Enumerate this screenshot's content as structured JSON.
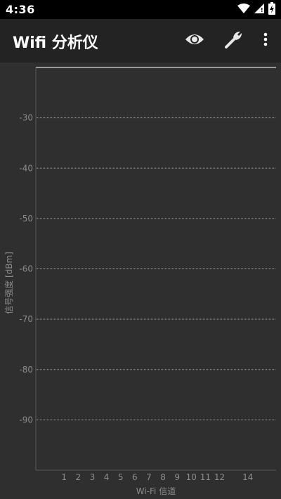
{
  "status_bar": {
    "time": "4:36"
  },
  "app_bar": {
    "title": "Wifi 分析仪",
    "actions": [
      {
        "name": "eye-icon"
      },
      {
        "name": "wrench-icon"
      },
      {
        "name": "more-vert-icon"
      }
    ]
  },
  "chart_data": {
    "type": "line",
    "xlabel": "Wi-Fi 信道",
    "ylabel": "信号强度 [dBm]",
    "x_ticks": [
      1,
      2,
      3,
      4,
      5,
      6,
      7,
      8,
      9,
      10,
      11,
      12,
      14
    ],
    "x_tick_labels": [
      "1",
      "2",
      "3",
      "4",
      "5",
      "6",
      "7",
      "8",
      "9",
      "10",
      "11",
      "12",
      "14"
    ],
    "y_ticks": [
      -30,
      -40,
      -50,
      -60,
      -70,
      -80,
      -90
    ],
    "y_tick_labels": [
      "-30",
      "-40",
      "-50",
      "-60",
      "-70",
      "-80",
      "-90"
    ],
    "ylim": [
      -100,
      -20
    ],
    "xlim": [
      -1,
      16
    ],
    "grid": true,
    "series": []
  }
}
